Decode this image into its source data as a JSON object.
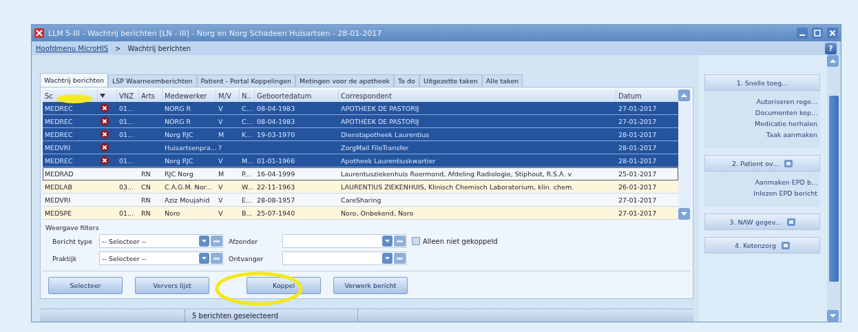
{
  "window": {
    "title": "LLM 5-III - Wachtrij berichten [LN - III] - Norg en Norg Schadeen Huisartsen - 28-01-2017"
  },
  "breadcrumb": {
    "link": "Hoofdmenu MicroHIS",
    "separator": ">",
    "current": "Wachtrij berichten",
    "help": "?"
  },
  "tabs": [
    {
      "label": "Wachtrij berichten",
      "selected": true
    },
    {
      "label": "LSP Waarneemberichten",
      "selected": false
    },
    {
      "label": "Patient - Portal Koppelingen",
      "selected": false
    },
    {
      "label": "Metingen voor de apotheek",
      "selected": false
    },
    {
      "label": "To do",
      "selected": false
    },
    {
      "label": "Uitgezette taken",
      "selected": false
    },
    {
      "label": "Alle taken",
      "selected": false
    }
  ],
  "table": {
    "columns": [
      "Sc",
      "",
      "VNZ",
      "Arts",
      "Medewerker",
      "M/V",
      "N..",
      "Geboortedatum",
      "Correspondent",
      "Datum"
    ],
    "rows": [
      {
        "selected": true,
        "focused": false,
        "flag": true,
        "cells": [
          "MEDREC",
          "",
          "01...",
          "",
          "NORG R",
          "V",
          "C...",
          "08-04-1983",
          "APOTHEEK DE PASTORIJ",
          "27-01-2017"
        ]
      },
      {
        "selected": true,
        "focused": false,
        "flag": true,
        "cells": [
          "MEDREC",
          "",
          "01...",
          "",
          "NORG R",
          "V",
          "C...",
          "08-04-1983",
          "APOTHEEK DE PASTORIJ",
          "27-01-2017"
        ]
      },
      {
        "selected": true,
        "focused": false,
        "flag": true,
        "cells": [
          "MEDREC",
          "",
          "01...",
          "",
          "Norg RJC",
          "M",
          "K...",
          "19-03-1970",
          "Dienstapotheek Laurentius",
          "28-01-2017"
        ]
      },
      {
        "selected": true,
        "focused": false,
        "flag": true,
        "cells": [
          "MEDVRI",
          "",
          "",
          "",
          "Huisartsenpra...",
          "?",
          "",
          "",
          "ZorgMail FileTransfer",
          "28-01-2017"
        ]
      },
      {
        "selected": true,
        "focused": false,
        "flag": true,
        "cells": [
          "MEDREC",
          "",
          "01...",
          "",
          "Norg RJC",
          "V",
          "M...",
          "01-01-1966",
          "Apotheek Laurentiuskwartier",
          "28-01-2017"
        ]
      },
      {
        "selected": false,
        "focused": true,
        "flag": false,
        "cells": [
          "MEDRAD",
          "",
          "",
          "RN",
          "RJC Norg",
          "M",
          "P...",
          "16-04-1999",
          "Laurentusziekenhuis Roermond, Afdeling Radiologie, Stiphout, R.S.A. v",
          "25-01-2017"
        ]
      },
      {
        "selected": false,
        "focused": false,
        "flag": false,
        "cells": [
          "MEDLAB",
          "",
          "03...",
          "CN",
          "C.A.G.M. Nor...",
          "V",
          "W...",
          "22-11-1963",
          "LAURENTIUS ZIEKENHUIS, Klinisch Chemisch Laboratorium, klin. chem.",
          "26-01-2017"
        ]
      },
      {
        "selected": false,
        "focused": false,
        "flag": false,
        "cells": [
          "MEDVRI",
          "",
          "",
          "RN",
          "Aziz Moujahid",
          "V",
          "E...",
          "28-08-1957",
          "CareSharing",
          "27-01-2017"
        ]
      },
      {
        "selected": false,
        "focused": false,
        "flag": false,
        "cells": [
          "MEDSPE",
          "",
          "01...",
          "RN",
          "Noro",
          "V",
          "B...",
          "25-07-1940",
          "Noro, Onbekend, Noro",
          "27-01-2017"
        ]
      }
    ]
  },
  "filters": {
    "title": "Weergave filters",
    "fields": [
      {
        "label": "Bericht type",
        "value": "-- Selecteer --"
      },
      {
        "label": "Afzender"
      },
      {
        "label": "Praktijk",
        "value": "-- Selecteer --"
      },
      {
        "label": "Ontvanger"
      }
    ],
    "checkbox": {
      "label": "Alleen niet gekoppeld",
      "checked": false
    }
  },
  "buttons": [
    "Selecteer",
    "Ververs lijst",
    "Koppel",
    "Verwerk bericht"
  ],
  "status_bar": {
    "text": "5 berichten geselecteerd"
  },
  "sidebar": [
    {
      "title": "1. Snelle toeg...",
      "button": false,
      "items": [
        "Autoriseren rege...",
        "Documenten kop...",
        "Medicatie herhalen",
        "Taak aanmaken"
      ]
    },
    {
      "title": "2. Patient ov...",
      "button": true,
      "items": [
        "Aanmaken EPD b...",
        "Inlezen EPD bericht"
      ]
    },
    {
      "title": "3. NAW gegev...",
      "button": true
    },
    {
      "title": "4. Ketenzorg",
      "button": true
    }
  ]
}
